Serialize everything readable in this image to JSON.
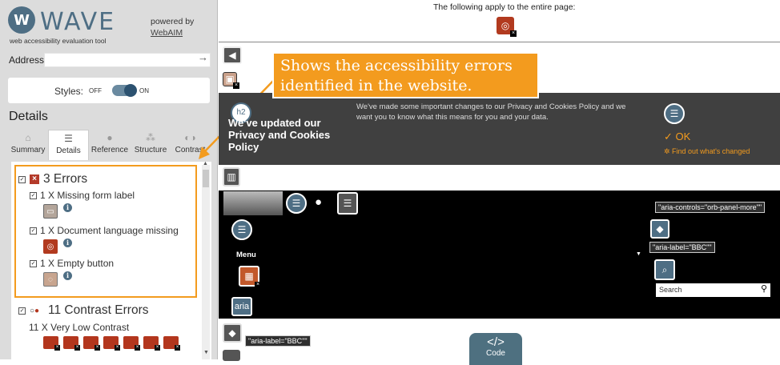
{
  "sidebar": {
    "logo_letter": "W",
    "logo_word": "WAVE",
    "logo_tagline": "web accessibility evaluation tool",
    "powered_by": "powered by",
    "powered_link": "WebAIM",
    "address_label": "Address:",
    "address_value": "",
    "styles_label": "Styles:",
    "styles_off": "OFF",
    "styles_on": "ON",
    "details_heading": "Details",
    "tabs": [
      {
        "label": "Summary",
        "icon": "home-icon"
      },
      {
        "label": "Details",
        "icon": "list-icon"
      },
      {
        "label": "Reference",
        "icon": "info-icon"
      },
      {
        "label": "Structure",
        "icon": "structure-icon"
      },
      {
        "label": "Contrast",
        "icon": "contrast-icon"
      }
    ],
    "errors": {
      "title": "3 Errors",
      "items": [
        {
          "label": "1 X Missing form label"
        },
        {
          "label": "1 X Document language missing"
        },
        {
          "label": "1 X Empty button"
        }
      ]
    },
    "contrast": {
      "title": "11 Contrast Errors",
      "sub": "11 X Very Low Contrast"
    }
  },
  "main": {
    "whole_page_note": "The following apply to the entire page:",
    "callout_text": "Shows the accessibility errors identified in the website.",
    "cookie": {
      "h2": "h2",
      "title": "We've updated our Privacy and Cookies Policy",
      "body": "We've made some important changes to our Privacy and Cookies Policy and we want you to know what this means for you and your data.",
      "ok": "OK",
      "find": "Find out what's changed"
    },
    "aria_controls": "\"aria-controls=\"orb-panel-more\"\"",
    "aria_label_bbc": "\"aria-label=\"BBC\"\"",
    "menu_label": "Menu",
    "aria_badge": "aria",
    "search_placeholder": "Search",
    "code_label": "Code",
    "code_glyph": "</>"
  },
  "colors": {
    "wave_blue": "#4e6e84",
    "error_red": "#b43a2a",
    "callout_orange": "#f39b1e"
  }
}
